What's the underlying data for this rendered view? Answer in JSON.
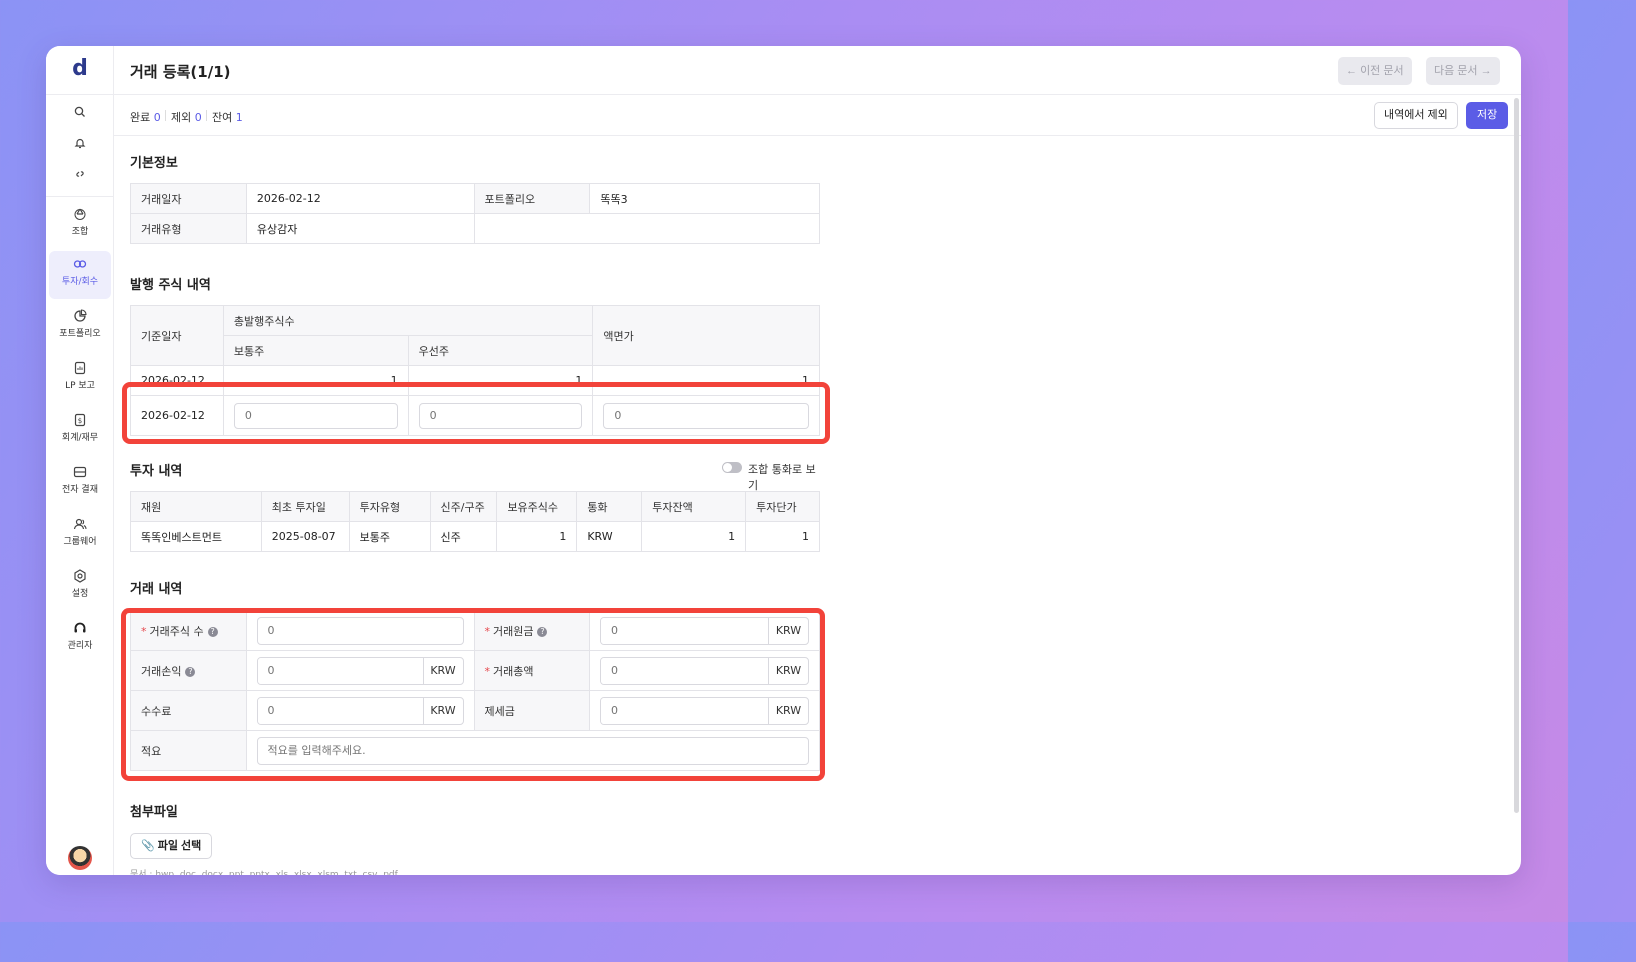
{
  "sidebar": {
    "logo": "d",
    "items": [
      {
        "label": "조합",
        "icon": "recycle-icon"
      },
      {
        "label": "투자/회수",
        "icon": "investment-icon",
        "active": true
      },
      {
        "label": "포트폴리오",
        "icon": "pie-chart-icon"
      },
      {
        "label": "LP 보고",
        "icon": "report-icon"
      },
      {
        "label": "회계/재무",
        "icon": "accounting-icon"
      },
      {
        "label": "전자 결재",
        "icon": "approval-icon"
      },
      {
        "label": "그룹웨어",
        "icon": "groupware-icon"
      },
      {
        "label": "설정",
        "icon": "settings-icon"
      },
      {
        "label": "관리자",
        "icon": "admin-icon"
      }
    ]
  },
  "header": {
    "title": "거래 등록(1/1)",
    "prev_label": "이전 문서",
    "next_label": "다음 문서"
  },
  "subbar": {
    "done_label": "완료",
    "done_count": "0",
    "excluded_label": "제외",
    "excluded_count": "0",
    "remaining_label": "잔여",
    "remaining_count": "1",
    "exclude_button": "내역에서 제외",
    "save_button": "저장"
  },
  "basic_info": {
    "title": "기본정보",
    "trade_date_label": "거래일자",
    "trade_date": "2026-02-12",
    "portfolio_label": "포트폴리오",
    "portfolio": "똑똑3",
    "trade_type_label": "거래유형",
    "trade_type": "유상감자"
  },
  "issued_shares": {
    "title": "발행 주식 내역",
    "col_base_date": "기준일자",
    "col_total_shares": "총발행주식수",
    "col_common": "보통주",
    "col_preferred": "우선주",
    "col_par_value": "액면가",
    "row1": {
      "date": "2026-02-12",
      "common": "1",
      "preferred": "1",
      "par": "1"
    },
    "row2": {
      "date": "2026-02-12",
      "common_placeholder": "0",
      "preferred_placeholder": "0",
      "par_placeholder": "0"
    }
  },
  "investment": {
    "title": "투자 내역",
    "toggle_label": "조합 통화로 보기",
    "headers": [
      "재원",
      "최초 투자일",
      "투자유형",
      "신주/구주",
      "보유주식수",
      "통화",
      "투자잔액",
      "투자단가"
    ],
    "row": [
      "똑똑인베스트먼트",
      "2025-08-07",
      "보통주",
      "신주",
      "1",
      "KRW",
      "1",
      "1"
    ]
  },
  "trade": {
    "title": "거래 내역",
    "shares_label": "거래주식 수",
    "shares_placeholder": "0",
    "principal_label": "거래원금",
    "principal_placeholder": "0",
    "pnl_label": "거래손익",
    "pnl_placeholder": "0",
    "total_label": "거래총액",
    "total_placeholder": "0",
    "fee_label": "수수료",
    "fee_placeholder": "0",
    "tax_label": "제세금",
    "tax_placeholder": "0",
    "memo_label": "적요",
    "memo_placeholder": "적요를 입력해주세요.",
    "currency": "KRW"
  },
  "attachment": {
    "title": "첨부파일",
    "button": "파일 선택",
    "hint": "문서 : hwp, doc, docx, ppt, pptx, xls, xlsx, xlsm, txt, csv, pdf"
  }
}
